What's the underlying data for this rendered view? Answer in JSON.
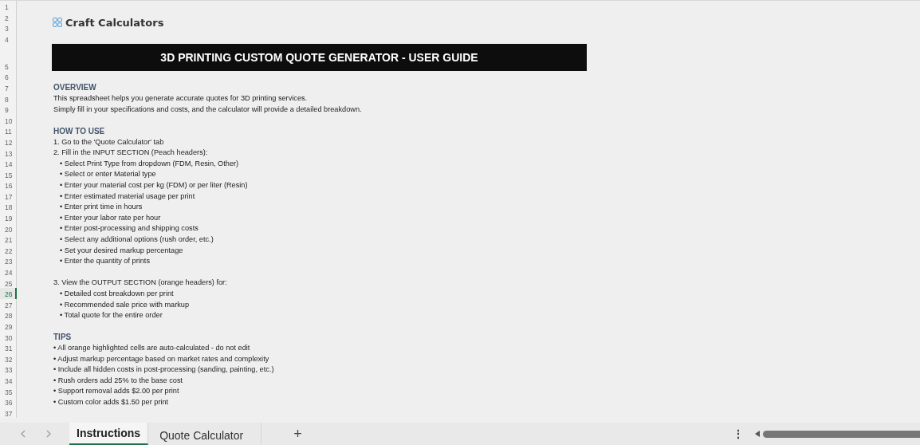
{
  "row_headers": [
    {
      "label": "1",
      "selected": false
    },
    {
      "label": "2",
      "selected": false
    },
    {
      "label": "3",
      "selected": false
    },
    {
      "label": "4",
      "selected": false
    },
    {
      "label": "5",
      "selected": false
    },
    {
      "label": "6",
      "selected": false
    },
    {
      "label": "7",
      "selected": false
    },
    {
      "label": "8",
      "selected": false
    },
    {
      "label": "9",
      "selected": false
    },
    {
      "label": "10",
      "selected": false
    },
    {
      "label": "11",
      "selected": false
    },
    {
      "label": "12",
      "selected": false
    },
    {
      "label": "13",
      "selected": false
    },
    {
      "label": "14",
      "selected": false
    },
    {
      "label": "15",
      "selected": false
    },
    {
      "label": "16",
      "selected": false
    },
    {
      "label": "17",
      "selected": false
    },
    {
      "label": "18",
      "selected": false
    },
    {
      "label": "19",
      "selected": false
    },
    {
      "label": "20",
      "selected": false
    },
    {
      "label": "21",
      "selected": false
    },
    {
      "label": "22",
      "selected": false
    },
    {
      "label": "23",
      "selected": false
    },
    {
      "label": "24",
      "selected": false
    },
    {
      "label": "25",
      "selected": false
    },
    {
      "label": "26",
      "selected": true
    },
    {
      "label": "27",
      "selected": false
    },
    {
      "label": "28",
      "selected": false
    },
    {
      "label": "29",
      "selected": false
    },
    {
      "label": "30",
      "selected": false
    },
    {
      "label": "31",
      "selected": false
    },
    {
      "label": "32",
      "selected": false
    },
    {
      "label": "33",
      "selected": false
    },
    {
      "label": "34",
      "selected": false
    },
    {
      "label": "35",
      "selected": false
    },
    {
      "label": "36",
      "selected": false
    },
    {
      "label": "37",
      "selected": false
    }
  ],
  "logo": {
    "text": "Craft Calculators"
  },
  "title": "3D PRINTING CUSTOM QUOTE GENERATOR - USER GUIDE",
  "sections": [
    {
      "heading": "OVERVIEW",
      "lines": [
        {
          "kind": "text",
          "text": "This spreadsheet helps you generate accurate quotes for 3D printing services."
        },
        {
          "kind": "text",
          "text": "Simply fill in your specifications and costs, and the calculator will provide a detailed breakdown."
        }
      ]
    },
    {
      "heading": "HOW TO USE",
      "lines": [
        {
          "kind": "text",
          "text": "1. Go to the 'Quote Calculator' tab"
        },
        {
          "kind": "text",
          "text": "2. Fill in the INPUT SECTION (Peach headers):"
        },
        {
          "kind": "sub",
          "text": "• Select Print Type from dropdown (FDM, Resin, Other)"
        },
        {
          "kind": "sub",
          "text": "• Select or enter Material type"
        },
        {
          "kind": "sub",
          "text": "• Enter your material cost per kg (FDM) or per liter (Resin)"
        },
        {
          "kind": "sub",
          "text": "• Enter estimated material usage per print"
        },
        {
          "kind": "sub",
          "text": "• Enter print time in hours"
        },
        {
          "kind": "sub",
          "text": "• Enter your labor rate per hour"
        },
        {
          "kind": "sub",
          "text": "• Enter post-processing and shipping costs"
        },
        {
          "kind": "sub",
          "text": "• Select any additional options (rush order, etc.)"
        },
        {
          "kind": "sub",
          "text": "• Set your desired markup percentage"
        },
        {
          "kind": "sub",
          "text": "• Enter the quantity of prints"
        },
        {
          "kind": "gap"
        },
        {
          "kind": "text",
          "text": "3. View the OUTPUT SECTION (orange headers) for:"
        },
        {
          "kind": "sub",
          "text": "• Detailed cost breakdown per print"
        },
        {
          "kind": "sub",
          "text": "• Recommended sale price with markup"
        },
        {
          "kind": "sub",
          "text": "• Total quote for the entire order"
        }
      ]
    },
    {
      "heading": "TIPS",
      "lines": [
        {
          "kind": "text",
          "text": "• All orange highlighted cells are auto-calculated - do not edit"
        },
        {
          "kind": "text",
          "text": "• Adjust markup percentage based on market rates and complexity"
        },
        {
          "kind": "text",
          "text": "• Include all hidden costs in post-processing (sanding, painting, etc.)"
        },
        {
          "kind": "text",
          "text": "• Rush orders add 25% to the base cost"
        },
        {
          "kind": "text",
          "text": "• Support removal adds $2.00 per print"
        },
        {
          "kind": "text",
          "text": "• Custom color adds $1.50 per print"
        }
      ]
    }
  ],
  "sheet_tabs": [
    {
      "label": "Instructions",
      "selected": true
    },
    {
      "label": "Quote Calculator",
      "selected": false
    }
  ],
  "add_sheet": "+",
  "more": "⋮"
}
